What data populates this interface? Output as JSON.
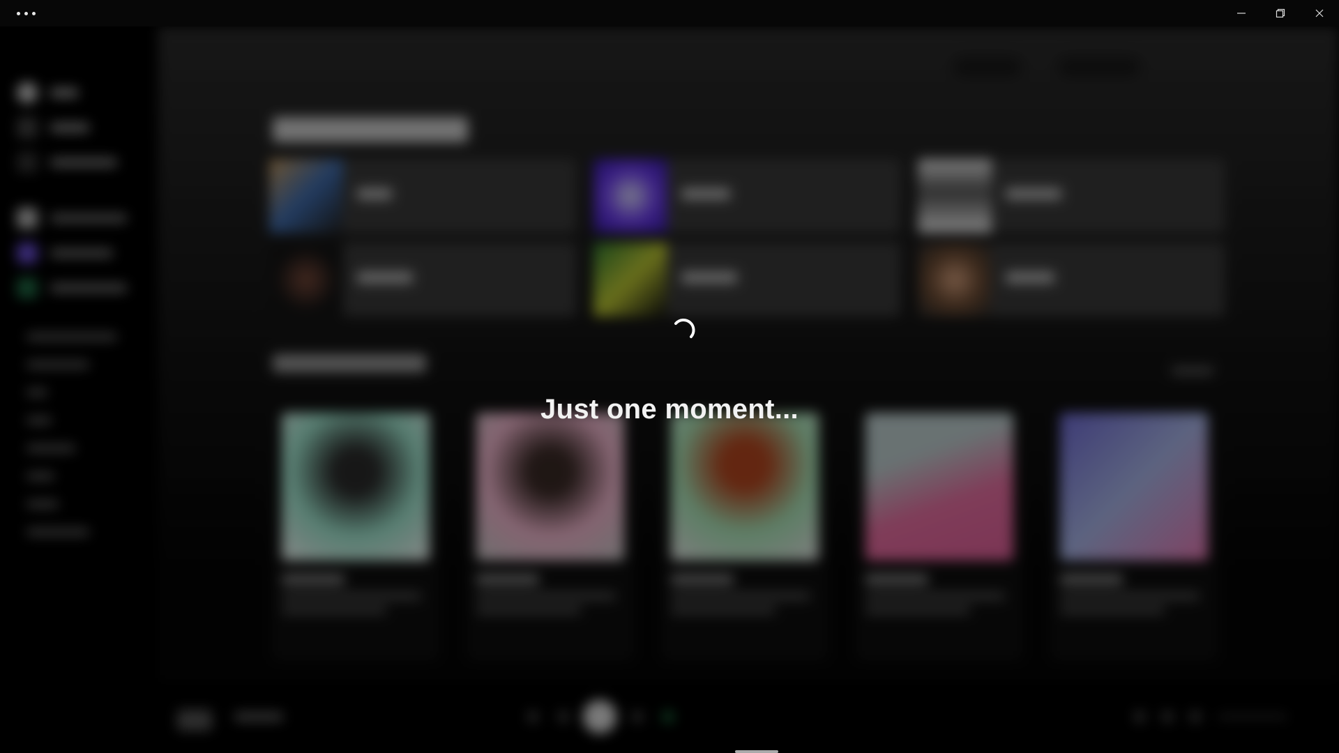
{
  "window": {
    "menu_icon": "more-horizontal-icon",
    "controls": [
      "minimize-icon",
      "restore-icon",
      "close-icon"
    ]
  },
  "loading": {
    "message": "Just one moment...",
    "spinner_icon": "spinner-icon"
  },
  "colors": {
    "background": "#000000",
    "overlay_text": "#f2f2f2",
    "accent": "#1db954"
  }
}
